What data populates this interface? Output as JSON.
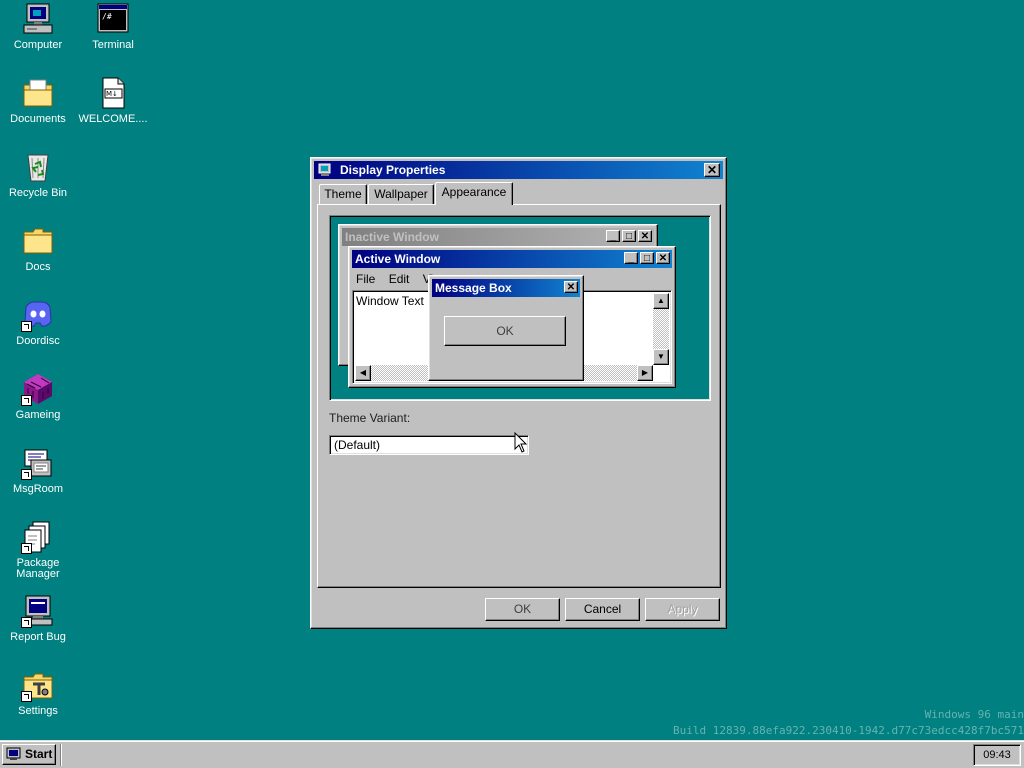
{
  "desktop": {
    "icons": [
      {
        "label": "Computer",
        "icon": "computer-icon"
      },
      {
        "label": "Terminal",
        "icon": "terminal-icon"
      },
      {
        "label": "Documents",
        "icon": "documents-folder-icon"
      },
      {
        "label": "WELCOME....",
        "icon": "markdown-file-icon"
      },
      {
        "label": "Recycle Bin",
        "icon": "recycle-bin-icon"
      },
      {
        "label": "Docs",
        "icon": "folder-icon"
      },
      {
        "label": "Doordisc",
        "icon": "doordisc-icon"
      },
      {
        "label": "Gameing",
        "icon": "gameing-icon"
      },
      {
        "label": "MsgRoom",
        "icon": "msgroom-icon"
      },
      {
        "label": "Package Manager",
        "icon": "package-manager-icon"
      },
      {
        "label": "Report Bug",
        "icon": "report-bug-icon"
      },
      {
        "label": "Settings",
        "icon": "settings-icon"
      }
    ],
    "terminal_glyph": "/#",
    "markdown_glyph": "M↓"
  },
  "dialog": {
    "title": "Display Properties",
    "close_glyph": "✕",
    "tabs": [
      "Theme",
      "Wallpaper",
      "Appearance"
    ],
    "active_tab": "Appearance",
    "preview": {
      "inactive_title": "Inactive Window",
      "active_title": "Active Window",
      "menu": [
        "File",
        "Edit",
        "Vie"
      ],
      "window_text": "Window Text",
      "message_title": "Message Box",
      "message_ok": "OK"
    },
    "theme_variant_label": "Theme Variant:",
    "theme_variant_value": "(Default)",
    "buttons": {
      "ok": "OK",
      "cancel": "Cancel",
      "apply": "Apply"
    }
  },
  "taskbar": {
    "start_label": "Start",
    "clock": "09:43"
  },
  "watermark": {
    "line1": "Windows 96 main",
    "line2": "Build 12839.88efa922.230410-1942.d77c73edcc428f7bc571"
  },
  "colors": {
    "desktop": "#008080",
    "title_active_start": "#000080",
    "title_active_end": "#1084d0",
    "face": "#c0c0c0"
  }
}
